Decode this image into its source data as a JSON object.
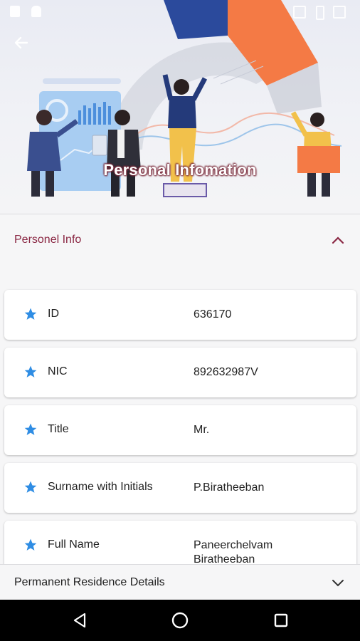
{
  "header": {
    "title": "Personal Infomation",
    "back_icon": "arrow-left-icon"
  },
  "section": {
    "title": "Personel Info",
    "expanded": true
  },
  "fields": [
    {
      "label": "ID",
      "value": "636170"
    },
    {
      "label": "NIC",
      "value": "892632987V"
    },
    {
      "label": "Title",
      "value": "Mr."
    },
    {
      "label": "Surname with Initials",
      "value": "P.Biratheeban"
    },
    {
      "label": "Full Name",
      "value": "Paneerchelvam Biratheeban"
    }
  ],
  "next_section": {
    "title": "Permanent Residence Details"
  },
  "colors": {
    "accent": "#8a2743",
    "star": "#2f8de4",
    "bar_orange": "#f47a45",
    "bar_blue": "#2b4a9c"
  },
  "navbar": {
    "back": "triangle-back-icon",
    "home": "circle-home-icon",
    "recents": "square-recents-icon"
  }
}
